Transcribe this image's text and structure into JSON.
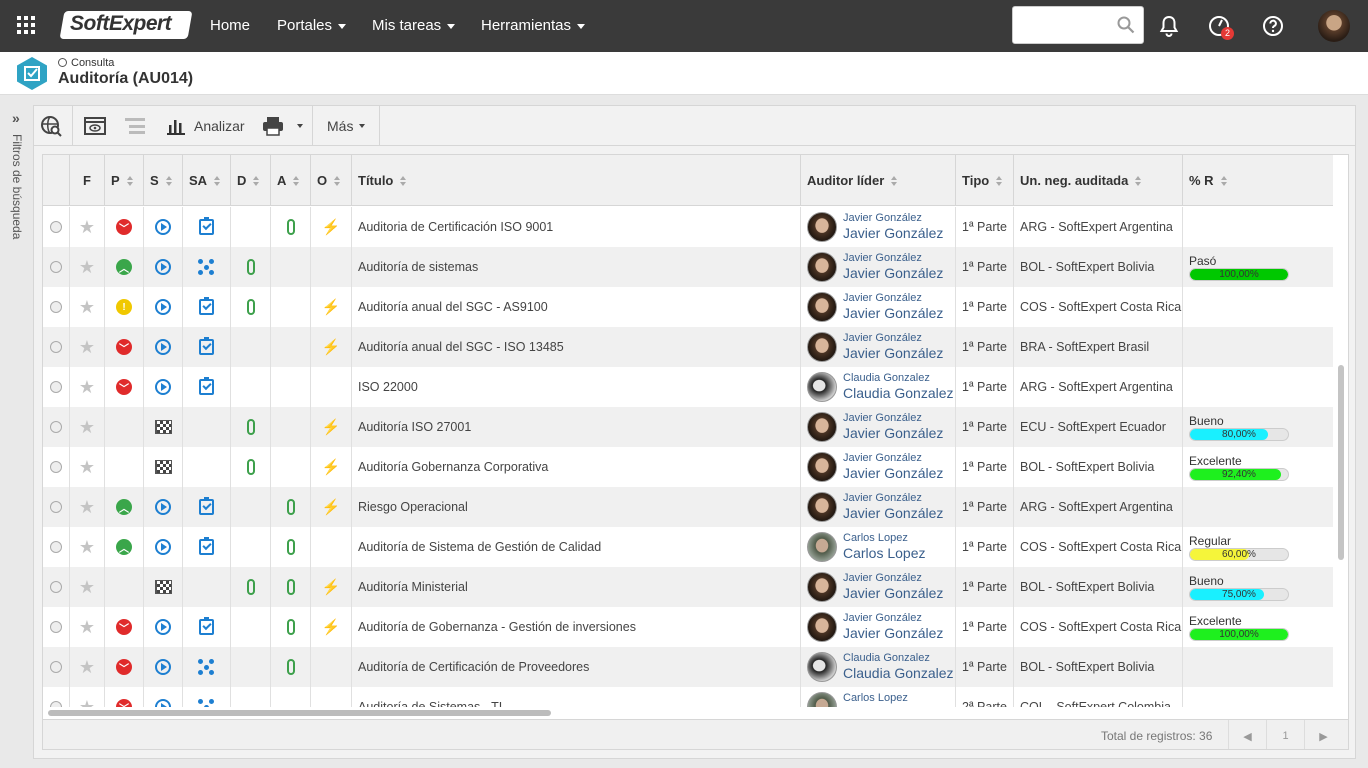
{
  "topbar": {
    "logo": "SoftExpert",
    "nav": [
      "Home",
      "Portales",
      "Mis tareas",
      "Herramientas"
    ],
    "search_placeholder": "",
    "notification_badge": "2"
  },
  "header": {
    "subtitle": "Consulta",
    "title": "Auditoría (AU014)"
  },
  "filter_tab": "Filtros de búsqueda",
  "toolbar": {
    "analyze": "Analizar",
    "more": "Más"
  },
  "columns": [
    "F",
    "P",
    "S",
    "SA",
    "D",
    "A",
    "O",
    "Título",
    "Auditor líder",
    "Tipo",
    "Un. neg. auditada",
    "% R"
  ],
  "rows": [
    {
      "p": "red",
      "s": "play",
      "sa": "task",
      "d": false,
      "a": true,
      "o": true,
      "title": "Auditoria de Certificación ISO 9001",
      "auditor": "Javier González",
      "pic": "javier",
      "tipo": "1ª Parte",
      "unit": "ARG - SoftExpert Argentina",
      "r_label": "",
      "r_value": "",
      "r_pct": 0,
      "r_color": ""
    },
    {
      "p": "green",
      "s": "play",
      "sa": "flow",
      "d": true,
      "a": false,
      "o": false,
      "title": "Auditoría de sistemas",
      "auditor": "Javier González",
      "pic": "javier",
      "tipo": "1ª Parte",
      "unit": "BOL - SoftExpert Bolivia",
      "r_label": "Pasó",
      "r_value": "100,00%",
      "r_pct": 100,
      "r_color": "#00c800"
    },
    {
      "p": "yellow",
      "s": "play",
      "sa": "task",
      "d": true,
      "a": false,
      "o": true,
      "title": "Auditoría anual del SGC - AS9100",
      "auditor": "Javier González",
      "pic": "javier",
      "tipo": "1ª Parte",
      "unit": "COS - SoftExpert Costa Rica",
      "r_label": "",
      "r_value": "",
      "r_pct": 0,
      "r_color": ""
    },
    {
      "p": "red",
      "s": "play",
      "sa": "task",
      "d": false,
      "a": false,
      "o": true,
      "title": "Auditoría anual del SGC - ISO 13485",
      "auditor": "Javier González",
      "pic": "javier",
      "tipo": "1ª Parte",
      "unit": "BRA - SoftExpert Brasil",
      "r_label": "",
      "r_value": "",
      "r_pct": 0,
      "r_color": ""
    },
    {
      "p": "red",
      "s": "play",
      "sa": "task",
      "d": false,
      "a": false,
      "o": false,
      "title": "ISO 22000",
      "auditor": "Claudia Gonzalez",
      "pic": "claudia",
      "tipo": "1ª Parte",
      "unit": "ARG - SoftExpert Argentina",
      "r_label": "",
      "r_value": "",
      "r_pct": 0,
      "r_color": ""
    },
    {
      "p": "",
      "s": "flag",
      "sa": "",
      "d": true,
      "a": false,
      "o": true,
      "title": "Auditoría ISO 27001",
      "auditor": "Javier González",
      "pic": "javier",
      "tipo": "1ª Parte",
      "unit": "ECU - SoftExpert Ecuador",
      "r_label": "Bueno",
      "r_value": "80,00%",
      "r_pct": 80,
      "r_color": "#19f0ff"
    },
    {
      "p": "",
      "s": "flag",
      "sa": "",
      "d": true,
      "a": false,
      "o": true,
      "title": "Auditoría Gobernanza Corporativa",
      "auditor": "Javier González",
      "pic": "javier",
      "tipo": "1ª Parte",
      "unit": "BOL - SoftExpert Bolivia",
      "r_label": "Excelente",
      "r_value": "92,40%",
      "r_pct": 92.4,
      "r_color": "#1ef01e"
    },
    {
      "p": "green",
      "s": "play",
      "sa": "task",
      "d": false,
      "a": true,
      "o": true,
      "title": "Riesgo Operacional",
      "auditor": "Javier González",
      "pic": "javier",
      "tipo": "1ª Parte",
      "unit": "ARG - SoftExpert Argentina",
      "r_label": "",
      "r_value": "",
      "r_pct": 0,
      "r_color": ""
    },
    {
      "p": "green",
      "s": "play",
      "sa": "task",
      "d": false,
      "a": true,
      "o": false,
      "title": "Auditoría de Sistema de Gestión de Calidad",
      "auditor": "Carlos Lopez",
      "pic": "carlos",
      "tipo": "1ª Parte",
      "unit": "COS - SoftExpert Costa Rica",
      "r_label": "Regular",
      "r_value": "60,00%",
      "r_pct": 60,
      "r_color": "#f5f53a"
    },
    {
      "p": "",
      "s": "flag",
      "sa": "",
      "d": true,
      "a": true,
      "o": true,
      "title": "Auditoría Ministerial",
      "auditor": "Javier González",
      "pic": "javier",
      "tipo": "1ª Parte",
      "unit": "BOL - SoftExpert Bolivia",
      "r_label": "Bueno",
      "r_value": "75,00%",
      "r_pct": 75,
      "r_color": "#19f0ff"
    },
    {
      "p": "red",
      "s": "play",
      "sa": "task",
      "d": false,
      "a": true,
      "o": true,
      "title": "Auditoría de Gobernanza - Gestión de inversiones",
      "auditor": "Javier González",
      "pic": "javier",
      "tipo": "1ª Parte",
      "unit": "COS - SoftExpert Costa Rica",
      "r_label": "Excelente",
      "r_value": "100,00%",
      "r_pct": 100,
      "r_color": "#1ef01e"
    },
    {
      "p": "red",
      "s": "play",
      "sa": "flow",
      "d": false,
      "a": true,
      "o": false,
      "title": "Auditoría de Certificación de Proveedores",
      "auditor": "Claudia Gonzalez",
      "pic": "claudia",
      "tipo": "1ª Parte",
      "unit": "BOL - SoftExpert Bolivia",
      "r_label": "",
      "r_value": "",
      "r_pct": 0,
      "r_color": ""
    },
    {
      "p": "red",
      "s": "play",
      "sa": "flow",
      "d": false,
      "a": false,
      "o": false,
      "title": "Auditoría de Sistemas - TI",
      "auditor": "Carlos Lopez",
      "pic": "carlos",
      "tipo": "2ª Parte",
      "unit": "COL - SoftExpert Colombia",
      "r_label": "",
      "r_value": "",
      "r_pct": 0,
      "r_color": ""
    }
  ],
  "footer": {
    "total": "Total de registros: 36",
    "page": "1"
  },
  "colors": {
    "topbar": "#3a3a3a",
    "red": "#e02b2b",
    "green": "#3aa64a",
    "yellow": "#f0c800",
    "blue": "#1d7fd1",
    "link": "#3a5f8c"
  }
}
